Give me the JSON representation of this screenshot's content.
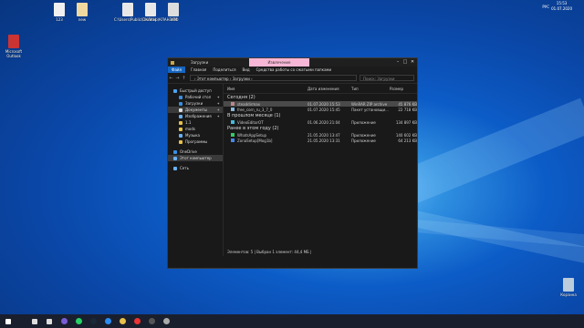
{
  "desktop": {
    "icons": [
      {
        "label": "123",
        "color": "#f0f0f0"
      },
      {
        "label": "new",
        "color": "#f0d9a0"
      },
      {
        "label": "C:\\Users\\Public\\Desktop\\КЛАН.NTD",
        "color": "#e8e8e8"
      },
      {
        "label": "КЛАН",
        "color": "#e8e8e8"
      },
      {
        "label": "ЗАМ",
        "color": "#ddd"
      },
      {
        "label": "Microsoft Outlook",
        "color": "#c33"
      },
      {
        "label": "Корзина",
        "color": "#bcd"
      }
    ]
  },
  "window": {
    "context_tab": "Извлечение",
    "title": "Загрузки",
    "ribbon": [
      "Файл",
      "Главная",
      "Поделиться",
      "Вид",
      "Средства работы со сжатыми папками"
    ],
    "address": "›  Этот компьютер  ›  Загрузки  ›",
    "search_placeholder": "Поиск: Загрузки",
    "columns": [
      "Имя",
      "Дата изменения",
      "Тип",
      "Размер"
    ],
    "sidebar": [
      {
        "label": "Быстрый доступ",
        "color": "#4ca3f0",
        "pin": false,
        "sel": false
      },
      {
        "label": "Рабочий стол",
        "color": "#3a8ee0",
        "pin": true,
        "sel": false
      },
      {
        "label": "Загрузки",
        "color": "#3a8ee0",
        "pin": true,
        "sel": false
      },
      {
        "label": "Документы",
        "color": "#ddd",
        "pin": true,
        "sel": true
      },
      {
        "label": "Изображения",
        "color": "#6ab0f5",
        "pin": true,
        "sel": false
      },
      {
        "label": "1.1",
        "color": "#e8c14a",
        "pin": false,
        "sel": false
      },
      {
        "label": "mods",
        "color": "#e8c14a",
        "pin": false,
        "sel": false
      },
      {
        "label": "Музыка",
        "color": "#6ab0f5",
        "pin": false,
        "sel": false
      },
      {
        "label": "Программы",
        "color": "#e8c14a",
        "pin": false,
        "sel": false
      },
      {
        "label": "OneDrive",
        "color": "#3a8ee0",
        "pin": false,
        "sel": false
      },
      {
        "label": "Этот компьютер",
        "color": "#6ab0f5",
        "pin": false,
        "sel": true
      },
      {
        "label": "Сеть",
        "color": "#6ab0f5",
        "pin": false,
        "sel": false
      }
    ],
    "groups": [
      {
        "title": "Сегодня (2)",
        "rows": [
          {
            "name": "steaddirmax",
            "date": "01.07.2020 15:53",
            "type": "WinRAR ZIP archive",
            "size": "45 876 KB",
            "color": "#b88",
            "sel": true
          },
          {
            "name": "free_corn_ru_3_7_0",
            "date": "01.07.2020 15:45",
            "type": "Пакет установщи...",
            "size": "22 718 KB",
            "color": "#8bd",
            "sel": false
          }
        ]
      },
      {
        "title": "В прошлом месяце (1)",
        "rows": [
          {
            "name": "VideoEditorOT",
            "date": "01.06.2020 21:04",
            "type": "Приложение",
            "size": "134 897 KB",
            "color": "#4bd",
            "sel": false
          }
        ]
      },
      {
        "title": "Ранее в этом году (2)",
        "rows": [
          {
            "name": "WhatsAppSetup",
            "date": "21.05.2020 13:47",
            "type": "Приложение",
            "size": "140 602 KB",
            "color": "#3c6",
            "sel": false
          },
          {
            "name": "ZonaSetup[Mog1b]",
            "date": "21.05.2020 13:31",
            "type": "Приложение",
            "size": "64 213 KB",
            "color": "#48e",
            "sel": false
          }
        ]
      }
    ],
    "status": "Элементов: 5   |   Выбран 1 элемент: 44,4 МБ   |"
  },
  "taskbar": {
    "icons": [
      {
        "name": "start",
        "color": "#fff"
      },
      {
        "name": "search",
        "color": "#ddd"
      },
      {
        "name": "task-view",
        "color": "#ddd"
      },
      {
        "name": "viber",
        "color": "#7b5cd6"
      },
      {
        "name": "whatsapp",
        "color": "#25d366"
      },
      {
        "name": "steam",
        "color": "#1b2838"
      },
      {
        "name": "edge",
        "color": "#2c8cf0"
      },
      {
        "name": "explorer",
        "color": "#e8c14a"
      },
      {
        "name": "yandex",
        "color": "#e33"
      },
      {
        "name": "app",
        "color": "#555"
      },
      {
        "name": "app2",
        "color": "#aaa"
      }
    ],
    "lang": "РУС",
    "time": "15:53",
    "date": "01.07.2020"
  }
}
